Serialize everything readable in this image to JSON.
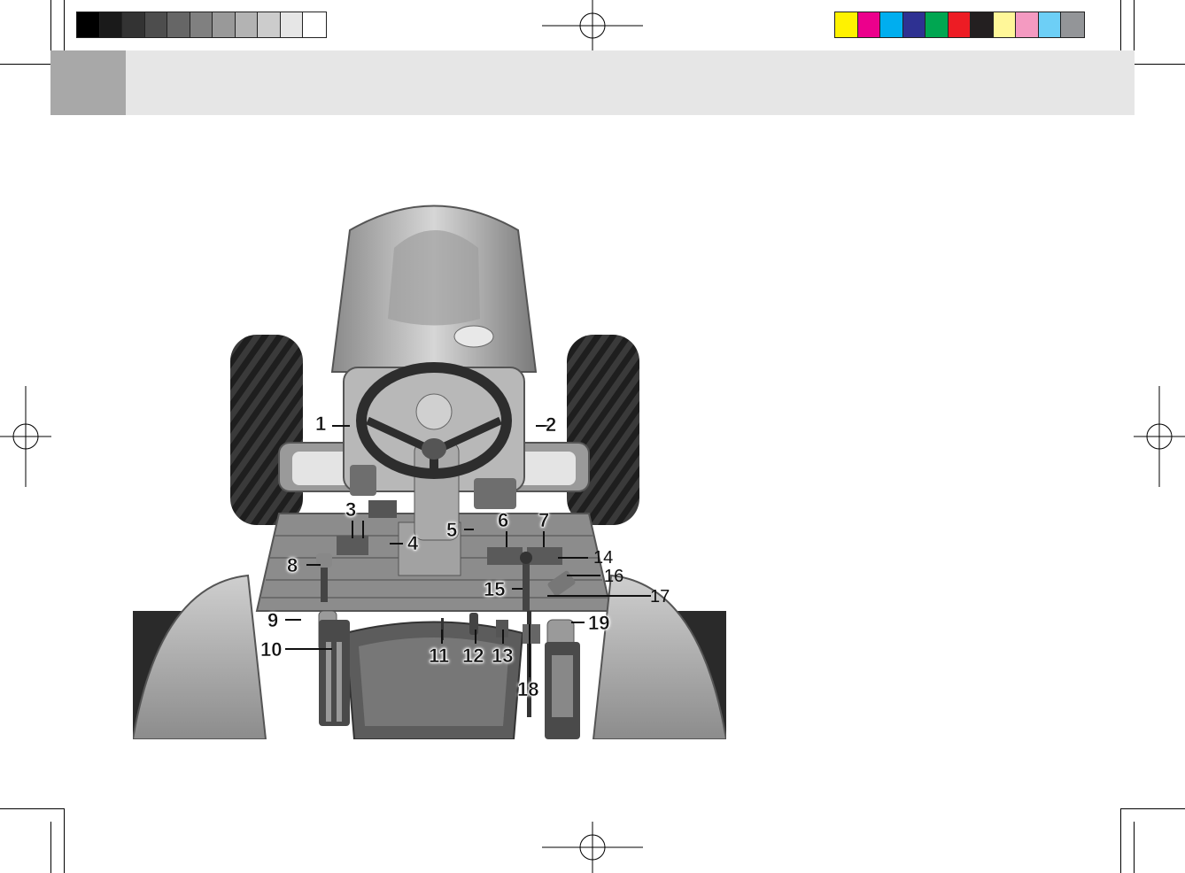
{
  "colors": {
    "header_band": "#e6e6e6",
    "header_tab": "#a8a8a8",
    "grayscale_bar": [
      "#000000",
      "#1a1a1a",
      "#333333",
      "#4d4d4d",
      "#666666",
      "#808080",
      "#999999",
      "#b3b3b3",
      "#cccccc",
      "#e6e6e6",
      "#ffffff"
    ],
    "color_bar": [
      "#fff200",
      "#ec008c",
      "#00aeef",
      "#2e3192",
      "#00a651",
      "#ed1c24",
      "#231f20",
      "#fff799",
      "#f49ac1",
      "#6dcff6",
      "#939598"
    ]
  },
  "figure": {
    "subject": "tractor operator station",
    "callouts": {
      "c1": "1",
      "c2": "2",
      "c3": "3",
      "c4": "4",
      "c5": "5",
      "c6": "6",
      "c7": "7",
      "c8": "8",
      "c9": "9",
      "c10": "10",
      "c11": "11",
      "c12": "12",
      "c13": "13",
      "c14": "14",
      "c15": "15",
      "c16": "16",
      "c17": "17",
      "c18": "18",
      "c19": "19"
    }
  }
}
